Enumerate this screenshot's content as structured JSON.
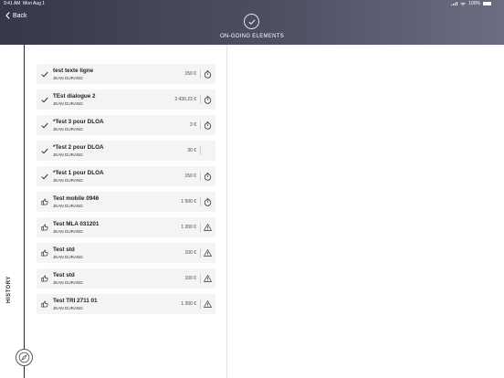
{
  "status_bar": {
    "time": "9:41 AM",
    "date": "Mon Aug 1",
    "battery": "100%"
  },
  "header": {
    "back_label": "Back",
    "title": "ON-GOING ELEMENTS",
    "icon": "check-circle-icon",
    "gradient": [
      "#36384a",
      "#6b6d82"
    ]
  },
  "sidebar": {
    "label": "HISTORY",
    "bottom_icon": "compass-icon"
  },
  "items": [
    {
      "title": "test texte ligne",
      "subtitle": "JEAN DURAND",
      "amount": "150 €",
      "lead": "check",
      "trail": "clock"
    },
    {
      "title": "TEst dialogue 2",
      "subtitle": "JEAN DURAND",
      "amount": "2 430.23 €",
      "lead": "check",
      "trail": "clock"
    },
    {
      "title": "*Test 3 pour DLOA",
      "subtitle": "JEAN DURAND",
      "amount": "3 €",
      "lead": "check",
      "trail": "clock"
    },
    {
      "title": "*Test 2 pour DLOA",
      "subtitle": "JEAN DURAND",
      "amount": "30 €",
      "lead": "check",
      "trail": "none"
    },
    {
      "title": "*Test 1 pour DLOA",
      "subtitle": "JEAN DURAND",
      "amount": "150 €",
      "lead": "check",
      "trail": "clock"
    },
    {
      "title": "Test mobile 0946",
      "subtitle": "JEAN DURAND",
      "amount": "1 500 €",
      "lead": "thumb",
      "trail": "clock"
    },
    {
      "title": "Test MLA 031201",
      "subtitle": "JEAN DURAND",
      "amount": "1 200 €",
      "lead": "thumb",
      "trail": "warning"
    },
    {
      "title": "Test std",
      "subtitle": "JEAN DURAND",
      "amount": "100 €",
      "lead": "thumb",
      "trail": "warning"
    },
    {
      "title": "Test std",
      "subtitle": "JEAN DURAND",
      "amount": "100 €",
      "lead": "thumb",
      "trail": "warning"
    },
    {
      "title": "Test TRI 2711 01",
      "subtitle": "JEAN DURAND",
      "amount": "1 200 €",
      "lead": "thumb",
      "trail": "warning"
    }
  ]
}
